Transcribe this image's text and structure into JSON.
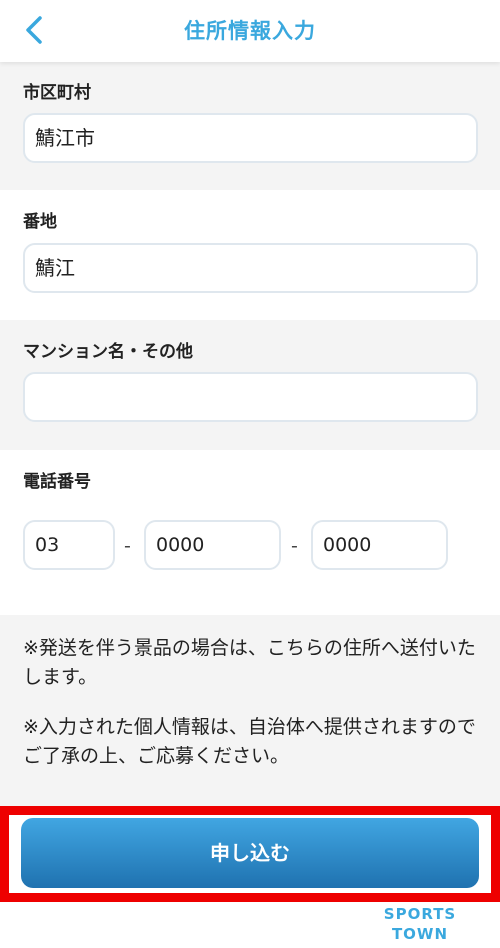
{
  "header": {
    "title": "住所情報入力"
  },
  "form": {
    "city": {
      "label": "市区町村",
      "value": "鯖江市"
    },
    "address": {
      "label": "番地",
      "value": "鯖江"
    },
    "building": {
      "label": "マンション名・その他",
      "value": ""
    },
    "phone": {
      "label": "電話番号",
      "part1": "03",
      "part2": "0000",
      "part3": "0000",
      "separator": "-"
    }
  },
  "notes": {
    "note1": "※発送を伴う景品の場合は、こちらの住所へ送付いたします。",
    "note2": "※入力された個人情報は、自治体へ提供されますのでご了承の上、ご応募ください。"
  },
  "submit": {
    "label": "申し込む"
  },
  "tabbar": {
    "brand_line1": "SPORTS",
    "brand_line2": "TOWN"
  },
  "colors": {
    "accent": "#3aa8de",
    "button": "#2a8fd0",
    "highlight": "#ee0000"
  }
}
